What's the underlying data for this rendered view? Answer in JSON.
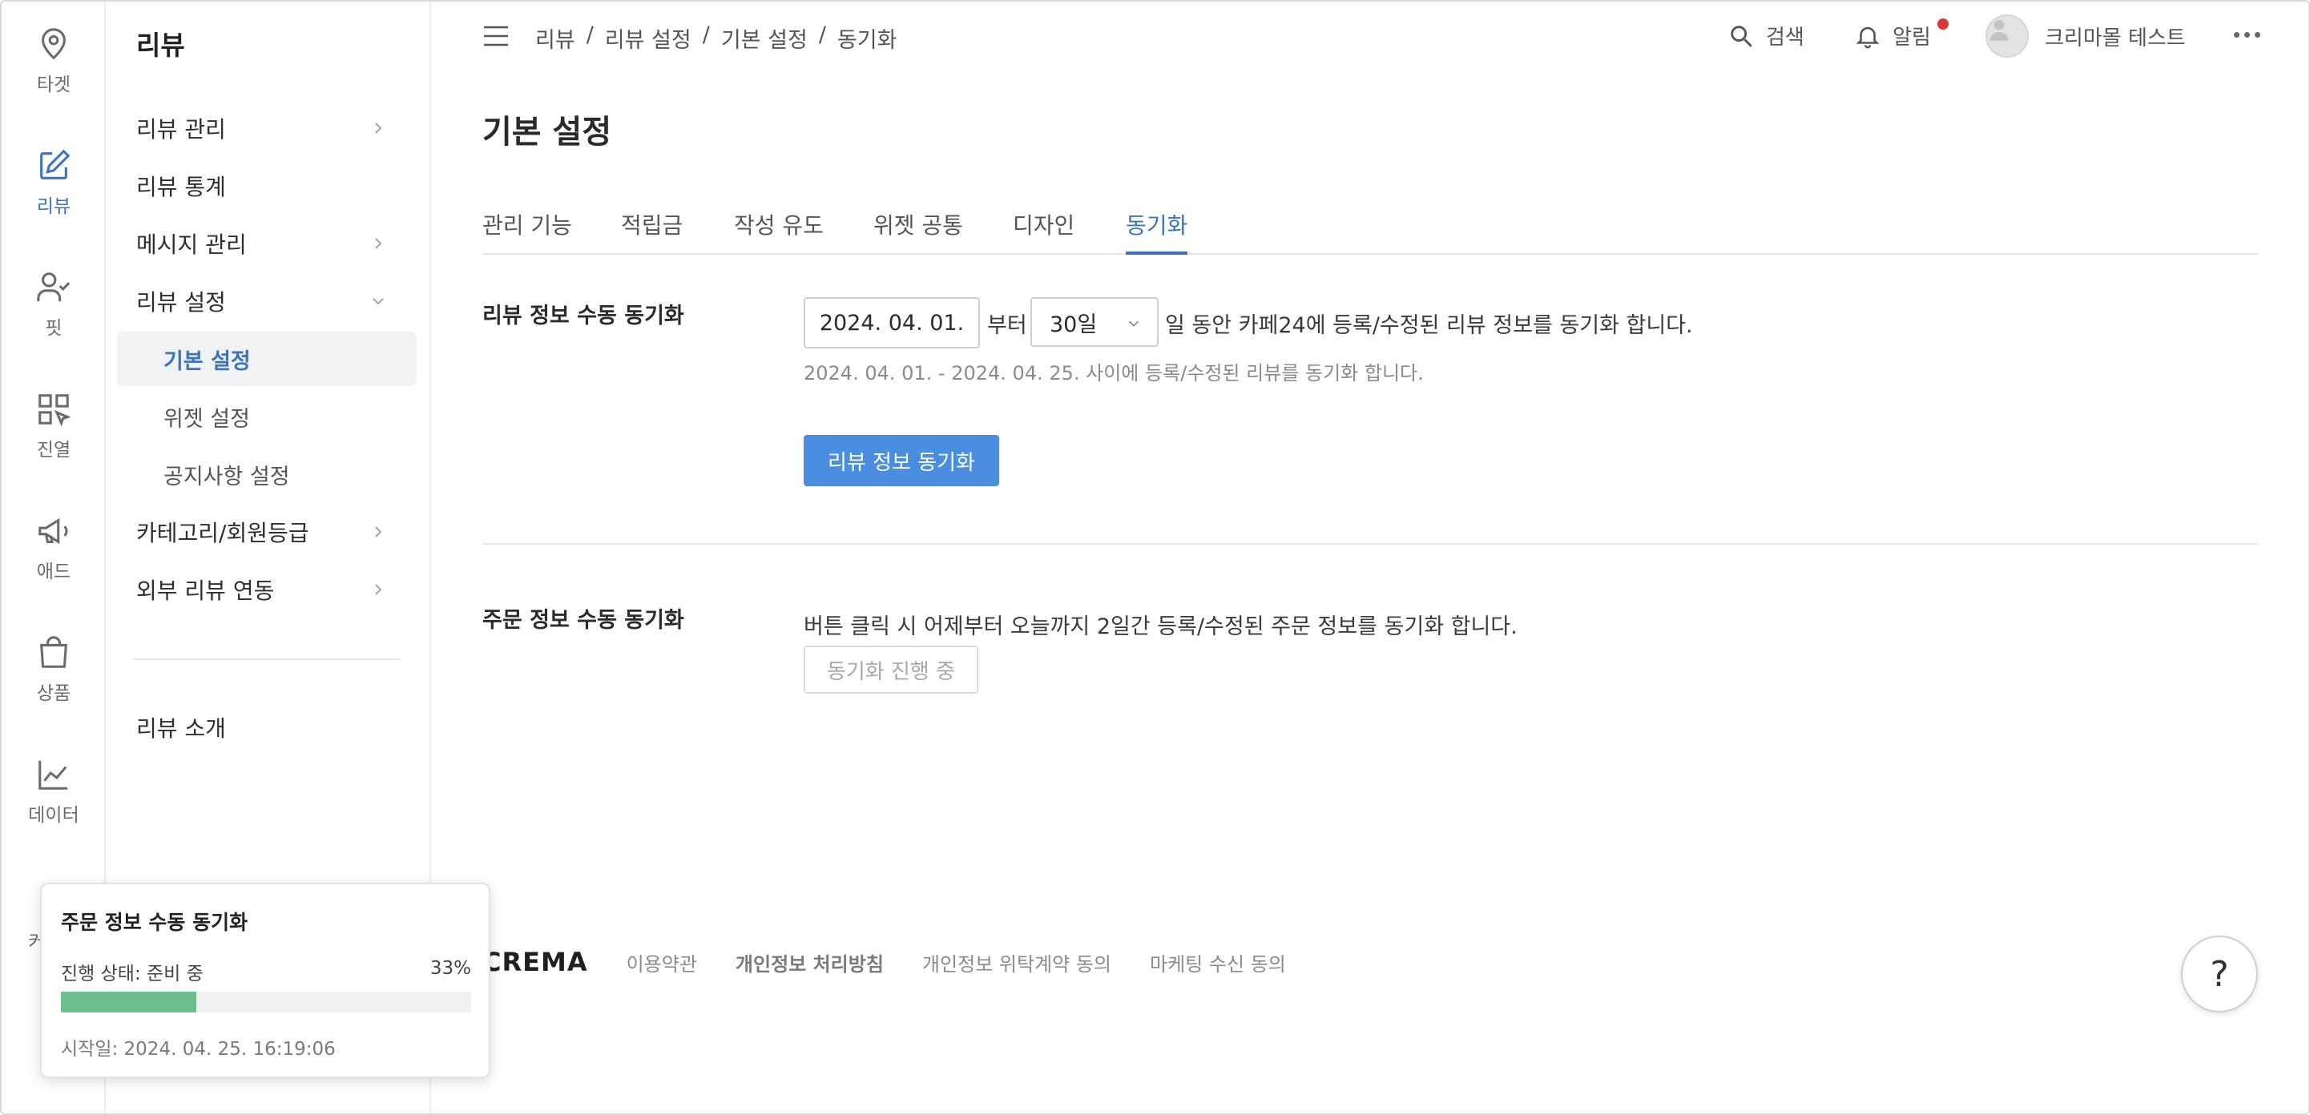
{
  "colors": {
    "accent": "#3c74ba",
    "primary_button": "#4a8ee0",
    "progress": "#6cbf8d",
    "notification": "#d9383a"
  },
  "rail": {
    "items": [
      {
        "label": "타겟",
        "icon": "map-pin-icon"
      },
      {
        "label": "리뷰",
        "icon": "edit-icon",
        "active": true
      },
      {
        "label": "핏",
        "icon": "user-check-icon"
      },
      {
        "label": "진열",
        "icon": "grid-cursor-icon"
      },
      {
        "label": "애드",
        "icon": "megaphone-icon"
      },
      {
        "label": "상품",
        "icon": "shopping-bag-icon"
      },
      {
        "label": "데이터",
        "icon": "chart-icon"
      },
      {
        "label": "커넥트",
        "icon": "connect-icon"
      }
    ]
  },
  "subnav": {
    "title": "리뷰",
    "items": [
      {
        "label": "리뷰 관리",
        "chevron": "right"
      },
      {
        "label": "리뷰 통계"
      },
      {
        "label": "메시지 관리",
        "chevron": "right"
      },
      {
        "label": "리뷰 설정",
        "chevron": "down"
      },
      {
        "label": "기본 설정",
        "active": true
      },
      {
        "label": "위젯 설정"
      },
      {
        "label": "공지사항 설정"
      },
      {
        "label": "카테고리/회원등급",
        "chevron": "right"
      },
      {
        "label": "외부 리뷰 연동",
        "chevron": "right"
      }
    ],
    "bottom_item": "리뷰 소개"
  },
  "header": {
    "breadcrumb": [
      "리뷰",
      "리뷰 설정",
      "기본 설정",
      "동기화"
    ],
    "breadcrumb_sep": "/",
    "search_label": "검색",
    "notifications_label": "알림",
    "user_name": "크리마몰 테스트"
  },
  "page": {
    "title": "기본 설정",
    "tabs": [
      "관리 기능",
      "적립금",
      "작성 유도",
      "위젯 공통",
      "디자인",
      "동기화"
    ],
    "active_tab": "동기화"
  },
  "review_sync": {
    "label": "리뷰 정보 수동 동기화",
    "date_value": "2024. 04. 01.",
    "from_text": "부터",
    "period_selected": "30일",
    "trailing_text": "일 동안 카페24에 등록/수정된 리뷰 정보를 동기화 합니다.",
    "hint": "2024. 04. 01. - 2024. 04. 25. 사이에 등록/수정된 리뷰를 동기화 합니다.",
    "button": "리뷰 정보 동기화"
  },
  "order_sync": {
    "label": "주문 정보 수동 동기화",
    "description": "버튼 클릭 시 어제부터 오늘까지 2일간 등록/수정된 주문 정보를 동기화 합니다.",
    "button": "동기화 진행 중"
  },
  "footer": {
    "brand": "CREMA",
    "links": [
      "이용약관",
      "개인정보 처리방침",
      "개인정보 위탁계약 동의",
      "마케팅 수신 동의"
    ]
  },
  "help": {
    "label": "?"
  },
  "progress_popover": {
    "title": "주문 정보 수동 동기화",
    "status": "진행 상태: 준비 중",
    "percent_text": "33%",
    "progress": 0.33,
    "started": "시작일: 2024. 04. 25. 16:19:06"
  }
}
